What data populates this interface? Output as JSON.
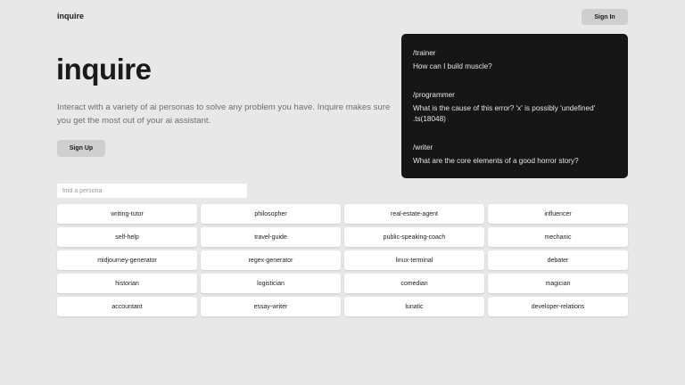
{
  "header": {
    "brand": "inquire",
    "signin_label": "Sign In"
  },
  "hero": {
    "title": "inquire",
    "description": "Interact with a variety of ai personas to solve any problem you have. Inquire makes sure you get the most out of your ai assistant.",
    "signup_label": "Sign Up"
  },
  "examples": [
    {
      "command": "/trainer",
      "question": "How can I build muscle?"
    },
    {
      "command": "/programmer",
      "question": "What is the cause of this error? 'x' is possibly 'undefined' .ts(18048)"
    },
    {
      "command": "/writer",
      "question": "What are the core elements of a good horror story?"
    }
  ],
  "search": {
    "placeholder": "find a persona",
    "value": ""
  },
  "personas": [
    "writing-tutor",
    "philosopher",
    "real-estate-agent",
    "influencer",
    "self-help",
    "travel-guide",
    "public-speaking-coach",
    "mechanic",
    "midjourney-generator",
    "regex-generator",
    "linux-terminal",
    "debater",
    "historian",
    "logistician",
    "comedian",
    "magician",
    "accountant",
    "essay-writer",
    "lunatic",
    "developer-relations"
  ]
}
